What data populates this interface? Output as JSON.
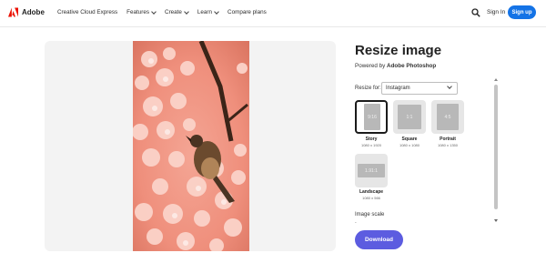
{
  "nav": {
    "brand": "Adobe",
    "links": [
      {
        "label": "Creative Cloud Express",
        "dropdown": false
      },
      {
        "label": "Features",
        "dropdown": true
      },
      {
        "label": "Create",
        "dropdown": true
      },
      {
        "label": "Learn",
        "dropdown": true
      },
      {
        "label": "Compare plans",
        "dropdown": false
      }
    ],
    "sign_in": "Sign In",
    "sign_up": "Sign up"
  },
  "panel": {
    "title": "Resize image",
    "powered_prefix": "Powered by",
    "powered_brand": "Adobe Photoshop",
    "resize_for_label": "Resize for:",
    "resize_for_value": "Instagram",
    "options": [
      {
        "ratio": "9:16",
        "name": "Story",
        "size": "1080 x 1920",
        "selected": true
      },
      {
        "ratio": "1:1",
        "name": "Square",
        "size": "1080 x 1080",
        "selected": false
      },
      {
        "ratio": "4:5",
        "name": "Portrait",
        "size": "1080 x 1350",
        "selected": false
      },
      {
        "ratio": "1.91:1",
        "name": "Landscape",
        "size": "1080 x 566",
        "selected": false
      }
    ],
    "image_scale_label": "Image scale",
    "image_scale_value": "-",
    "download": "Download"
  },
  "colors": {
    "brand_red": "#eb1000",
    "signup_blue": "#1473e6",
    "download_purple": "#5c5ce0",
    "preview_bg": "#f3f3f3"
  },
  "icons": [
    "adobe-logo-icon",
    "chevron-down-icon",
    "search-icon"
  ]
}
